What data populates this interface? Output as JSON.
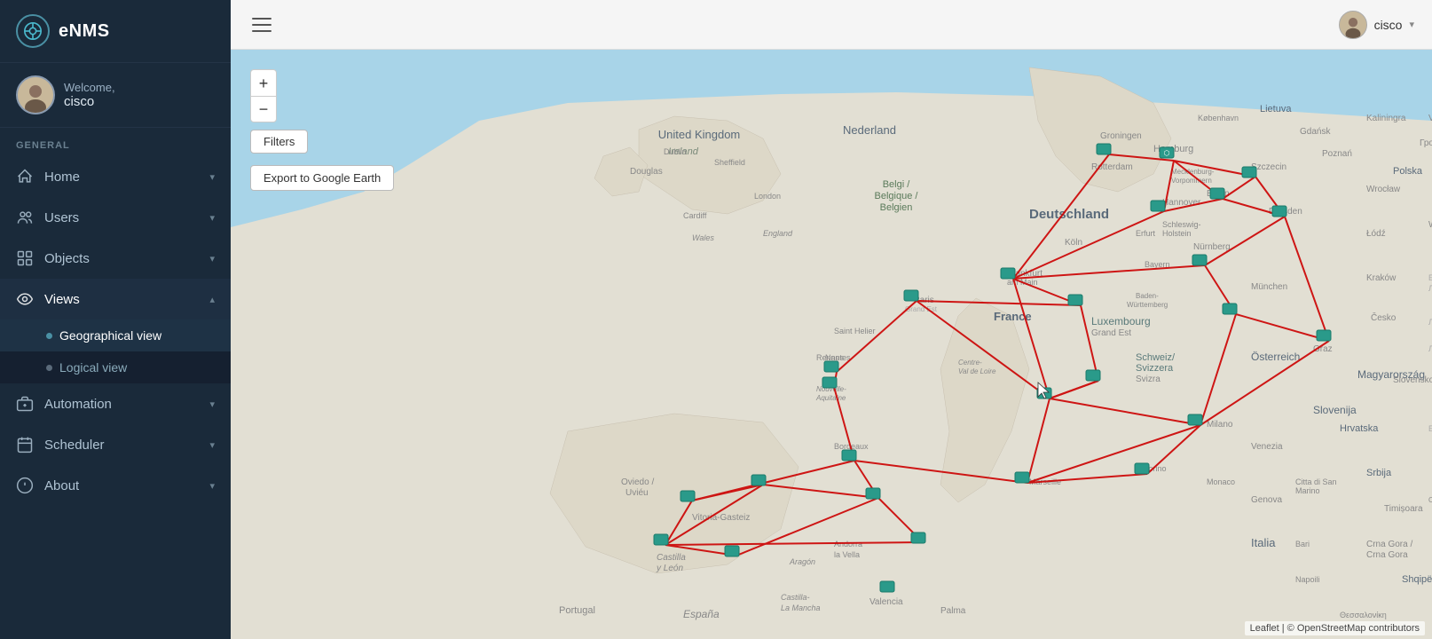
{
  "app": {
    "title": "eNMS"
  },
  "user": {
    "welcome": "Welcome,",
    "username": "cisco",
    "menu_label": "cisco"
  },
  "sidebar": {
    "general_label": "GENERAL",
    "items": [
      {
        "id": "home",
        "label": "Home",
        "icon": "home",
        "has_children": true,
        "expanded": false
      },
      {
        "id": "users",
        "label": "Users",
        "icon": "users",
        "has_children": true,
        "expanded": false
      },
      {
        "id": "objects",
        "label": "Objects",
        "icon": "objects",
        "has_children": true,
        "expanded": false
      },
      {
        "id": "views",
        "label": "Views",
        "icon": "views",
        "has_children": true,
        "expanded": true
      },
      {
        "id": "automation",
        "label": "Automation",
        "icon": "automation",
        "has_children": true,
        "expanded": false
      },
      {
        "id": "scheduler",
        "label": "Scheduler",
        "icon": "scheduler",
        "has_children": true,
        "expanded": false
      },
      {
        "id": "about",
        "label": "About",
        "icon": "about",
        "has_children": true,
        "expanded": false
      }
    ],
    "views_subitems": [
      {
        "id": "geo",
        "label": "Geographical view",
        "active": true
      },
      {
        "id": "logical",
        "label": "Logical view",
        "active": false
      }
    ]
  },
  "topbar": {
    "user_label": "cisco"
  },
  "map": {
    "filters_label": "Filters",
    "export_label": "Export to Google Earth",
    "zoom_in": "+",
    "zoom_out": "−",
    "attribution_text": "Leaflet | © OpenStreetMap contributors"
  }
}
